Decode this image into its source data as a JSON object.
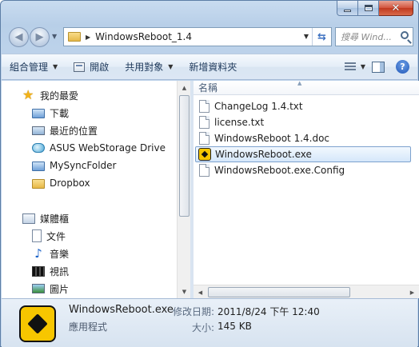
{
  "address": {
    "path": "WindowsReboot_1.4"
  },
  "search": {
    "placeholder": "搜尋 Wind..."
  },
  "toolbar": {
    "organize": "組合管理",
    "open": "開啟",
    "share": "共用對象",
    "new_folder": "新增資料夾"
  },
  "nav": {
    "favorites": "我的最愛",
    "items": [
      "下載",
      "最近的位置",
      "ASUS WebStorage Drive",
      "MySyncFolder",
      "Dropbox"
    ],
    "libraries": "媒體櫃",
    "lib_items": [
      "文件",
      "音樂",
      "視訊",
      "圖片"
    ]
  },
  "columns": {
    "name": "名稱"
  },
  "files": [
    {
      "name": "ChangeLog 1.4.txt",
      "icon": "text-file-icon"
    },
    {
      "name": "license.txt",
      "icon": "text-file-icon"
    },
    {
      "name": "WindowsReboot 1.4.doc",
      "icon": "text-file-icon"
    },
    {
      "name": "WindowsReboot.exe",
      "icon": "exe-icon",
      "selected": true
    },
    {
      "name": "WindowsReboot.exe.Config",
      "icon": "text-file-icon"
    }
  ],
  "details": {
    "name": "WindowsReboot.exe",
    "type": "應用程式",
    "modified_label": "修改日期:",
    "modified_value": "2011/8/24 下午 12:40",
    "size_label": "大小:",
    "size_value": "145 KB"
  },
  "colors": {
    "accent": "#3b6fc0",
    "exe_yellow": "#f7c600",
    "selection": "#d5e7fa"
  }
}
